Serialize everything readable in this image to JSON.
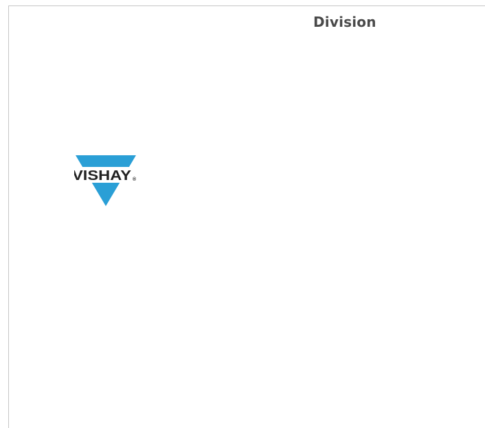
{
  "header": {
    "title": "Division"
  },
  "logo": {
    "text": "VISHAY",
    "mark": "®",
    "colors": {
      "triangle": "#2a9fd6",
      "text": "#222222",
      "band": "#ffffff"
    }
  }
}
